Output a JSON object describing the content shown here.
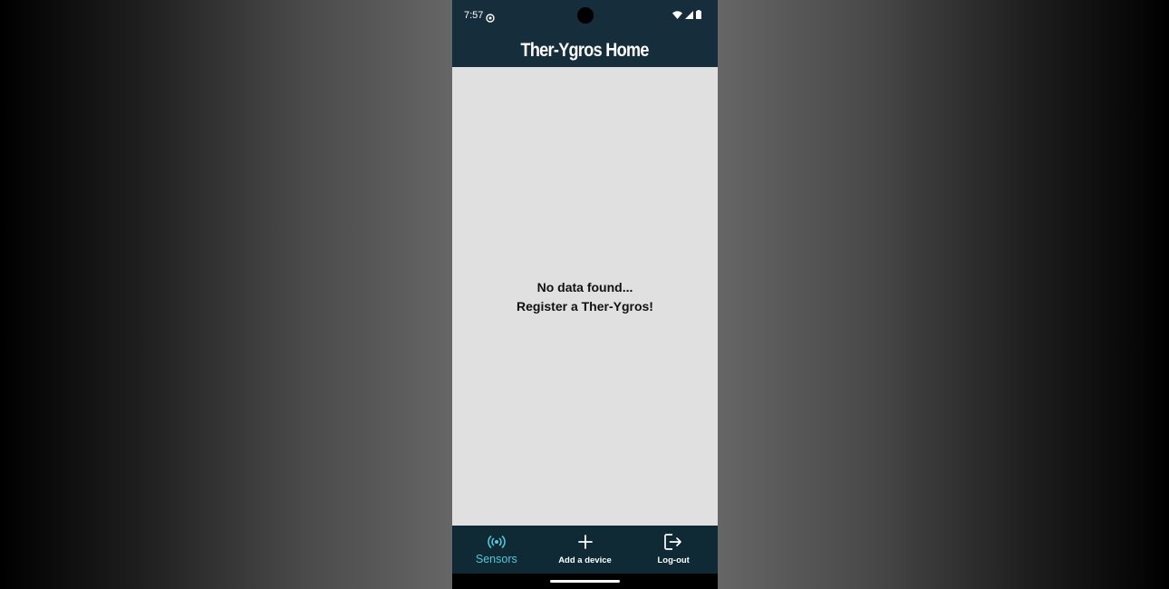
{
  "status_bar": {
    "time": "7:57",
    "notification_icon": "media-icon",
    "icons": [
      "wifi-icon",
      "signal-icon",
      "battery-icon"
    ]
  },
  "app_bar": {
    "title": "Ther-Ygros Home"
  },
  "content": {
    "empty_line_1": "No data found...",
    "empty_line_2": "Register a Ther-Ygros!"
  },
  "bottom_nav": {
    "items": [
      {
        "label": "Sensors",
        "icon": "sensors-icon",
        "active": true
      },
      {
        "label": "Add a device",
        "icon": "plus-icon",
        "active": false
      },
      {
        "label": "Log-out",
        "icon": "logout-icon",
        "active": false
      }
    ]
  },
  "colors": {
    "primary_dark": "#162d3b",
    "nav_background": "#0f2a34",
    "accent": "#52c8d8",
    "content_background": "#e0e0e0"
  }
}
